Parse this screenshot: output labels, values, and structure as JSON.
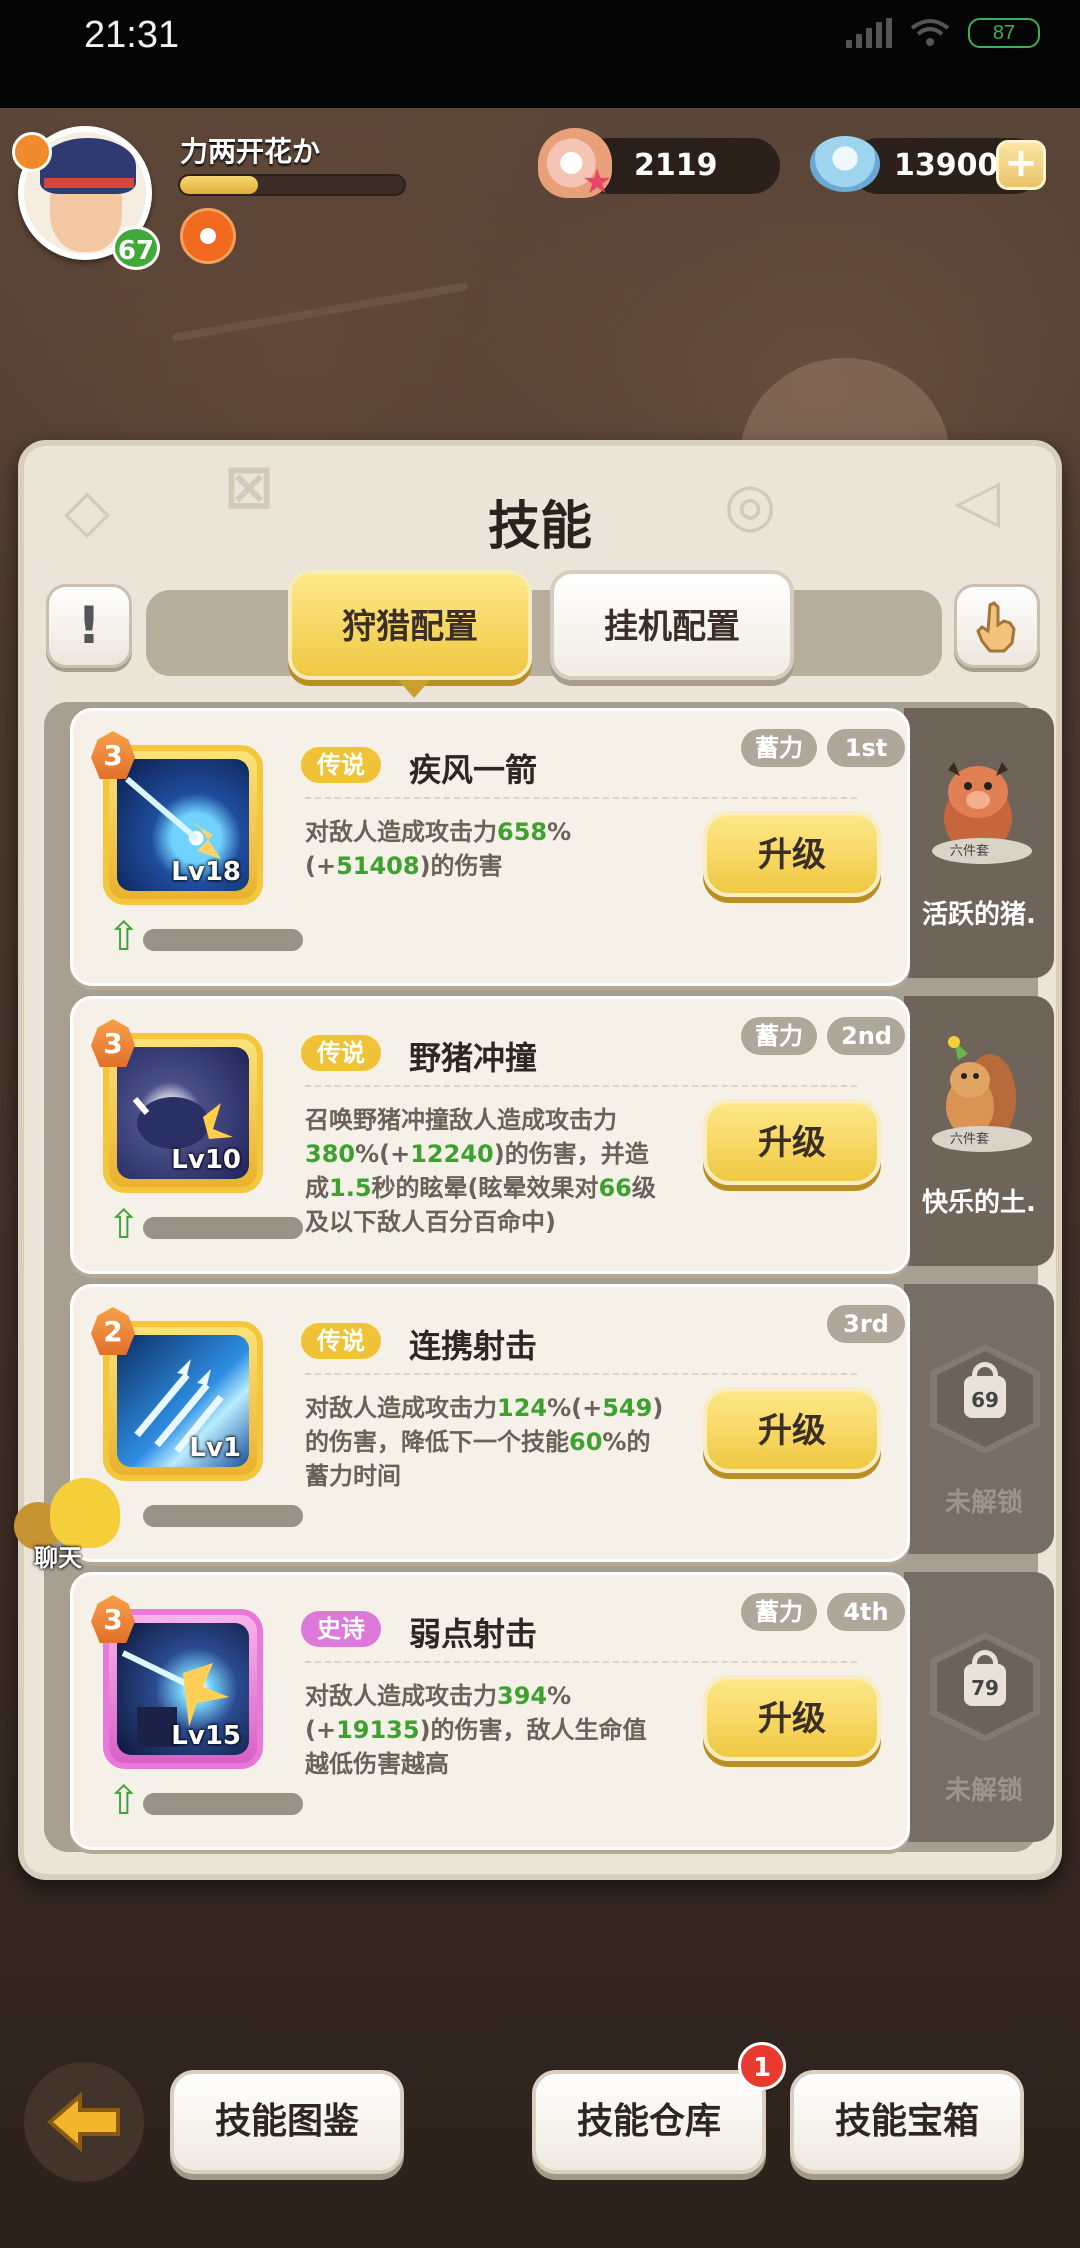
{
  "status_bar": {
    "time": "21:31",
    "battery": "87"
  },
  "player": {
    "name": "力两开花か",
    "level": "67",
    "exp_fraction": 0.35
  },
  "currency": {
    "pearls": "2119",
    "gems": "13900",
    "add_label": "+"
  },
  "panel": {
    "title": "技能",
    "info_label": "!",
    "tabs": [
      {
        "label": "狩猎配置",
        "active": true
      },
      {
        "label": "挂机配置",
        "active": false
      }
    ]
  },
  "skills": [
    {
      "stars": "3",
      "level": "Lv18",
      "rarity": "传说",
      "name": "疾风一箭",
      "tag_charge": "蓄力",
      "order": "1st",
      "desc": [
        [
          "t",
          "对敌人造成攻击力"
        ],
        [
          "g",
          "658"
        ],
        [
          "t",
          "%(+"
        ],
        [
          "g",
          "51408"
        ],
        [
          "t",
          ")的伤害"
        ]
      ],
      "upgrade": "升级",
      "side": {
        "type": "pet",
        "name": "活跃的猪.",
        "base_label": "六件套"
      }
    },
    {
      "stars": "3",
      "level": "Lv10",
      "rarity": "传说",
      "name": "野猪冲撞",
      "tag_charge": "蓄力",
      "order": "2nd",
      "desc": [
        [
          "t",
          "召唤野猪冲撞敌人造成攻击力"
        ],
        [
          "g",
          "380"
        ],
        [
          "t",
          "%(+"
        ],
        [
          "g",
          "12240"
        ],
        [
          "t",
          ")的伤害，并造成"
        ],
        [
          "g",
          "1.5"
        ],
        [
          "t",
          "秒的眩晕(眩晕效果对"
        ],
        [
          "g",
          "66"
        ],
        [
          "t",
          "级及以下敌人百分百命中)"
        ]
      ],
      "upgrade": "升级",
      "side": {
        "type": "pet",
        "name": "快乐的土.",
        "base_label": "六件套"
      }
    },
    {
      "stars": "2",
      "level": "Lv1",
      "rarity": "传说",
      "name": "连携射击",
      "tag_charge": "",
      "order": "3rd",
      "desc": [
        [
          "t",
          "对敌人造成攻击力"
        ],
        [
          "g",
          "124"
        ],
        [
          "t",
          "%(+"
        ],
        [
          "g",
          "549"
        ],
        [
          "t",
          ")的伤害，降低下一个技能"
        ],
        [
          "g",
          "60"
        ],
        [
          "t",
          "%的蓄力时间"
        ]
      ],
      "upgrade": "升级",
      "side": {
        "type": "locked",
        "unlock_level": "69",
        "text": "未解锁"
      }
    },
    {
      "stars": "3",
      "level": "Lv15",
      "rarity": "史诗",
      "name": "弱点射击",
      "tag_charge": "蓄力",
      "order": "4th",
      "desc": [
        [
          "t",
          "对敌人造成攻击力"
        ],
        [
          "g",
          "394"
        ],
        [
          "t",
          "%(+"
        ],
        [
          "g",
          "19135"
        ],
        [
          "t",
          ")的伤害，敌人生命值越低伤害越高"
        ]
      ],
      "upgrade": "升级",
      "side": {
        "type": "locked",
        "unlock_level": "79",
        "text": "未解锁"
      }
    }
  ],
  "chat": {
    "label": "聊天"
  },
  "bottom": {
    "back_icon": "arrow-left-icon",
    "codex": "技能图鉴",
    "store": "技能仓库",
    "store_badge": "1",
    "chest": "技能宝箱"
  },
  "colors": {
    "legend": "#f0c236",
    "epic": "#dd79d8",
    "value_green": "#3ea12f",
    "button_gold": "#f0c842"
  }
}
